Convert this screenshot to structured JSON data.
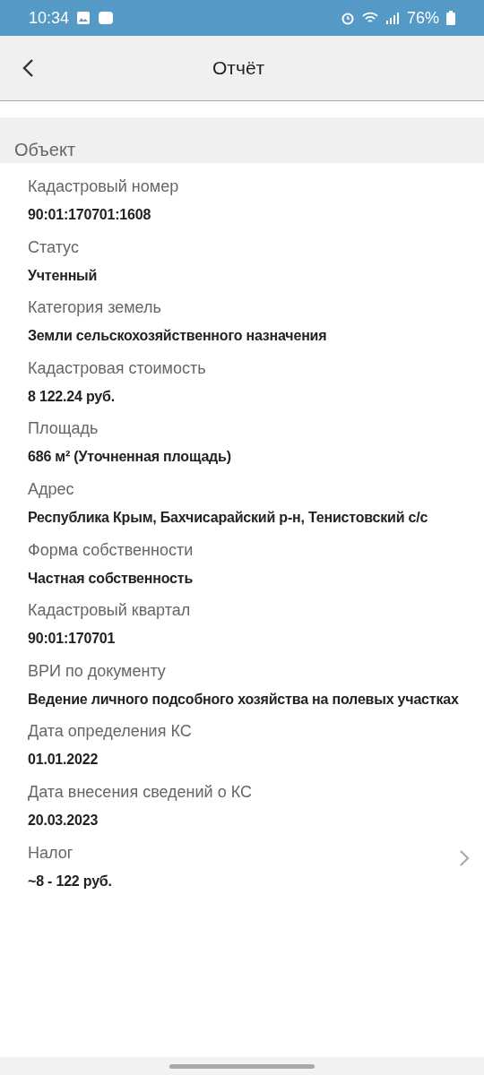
{
  "status_bar": {
    "time": "10:34",
    "battery": "76%"
  },
  "header": {
    "title": "Отчёт"
  },
  "section": {
    "title": "Объект"
  },
  "fields": [
    {
      "kind": "plain",
      "label": "Кадастровый номер",
      "value": "90:01:170701:1608"
    },
    {
      "kind": "plain",
      "label": "Статус",
      "value": "Учтенный"
    },
    {
      "kind": "plain",
      "label": "Категория земель",
      "value": "Земли сельскохозяйственного назначения"
    },
    {
      "kind": "plain",
      "label": "Кадастровая стоимость",
      "value": "8 122.24 руб."
    },
    {
      "kind": "plain",
      "label": "Площадь",
      "value": "686 м² (Уточненная площадь)"
    },
    {
      "kind": "plain",
      "label": "Адрес",
      "value": "Республика Крым, Бахчисарайский р-н, Тенистовский с/с"
    },
    {
      "kind": "plain",
      "label": "Форма собственности",
      "value": "Частная собственность"
    },
    {
      "kind": "plain",
      "label": "Кадастровый квартал",
      "value": "90:01:170701"
    },
    {
      "kind": "plain",
      "label": "ВРИ по документу",
      "value": "Ведение личного подсобного хозяйства на полевых участках"
    },
    {
      "kind": "plain",
      "label": "Дата определения КС",
      "value": "01.01.2022"
    },
    {
      "kind": "plain",
      "label": "Дата внесения сведений о КС",
      "value": "20.03.2023"
    },
    {
      "kind": "link",
      "label": "Налог",
      "value": "~8 - 122 руб."
    }
  ]
}
